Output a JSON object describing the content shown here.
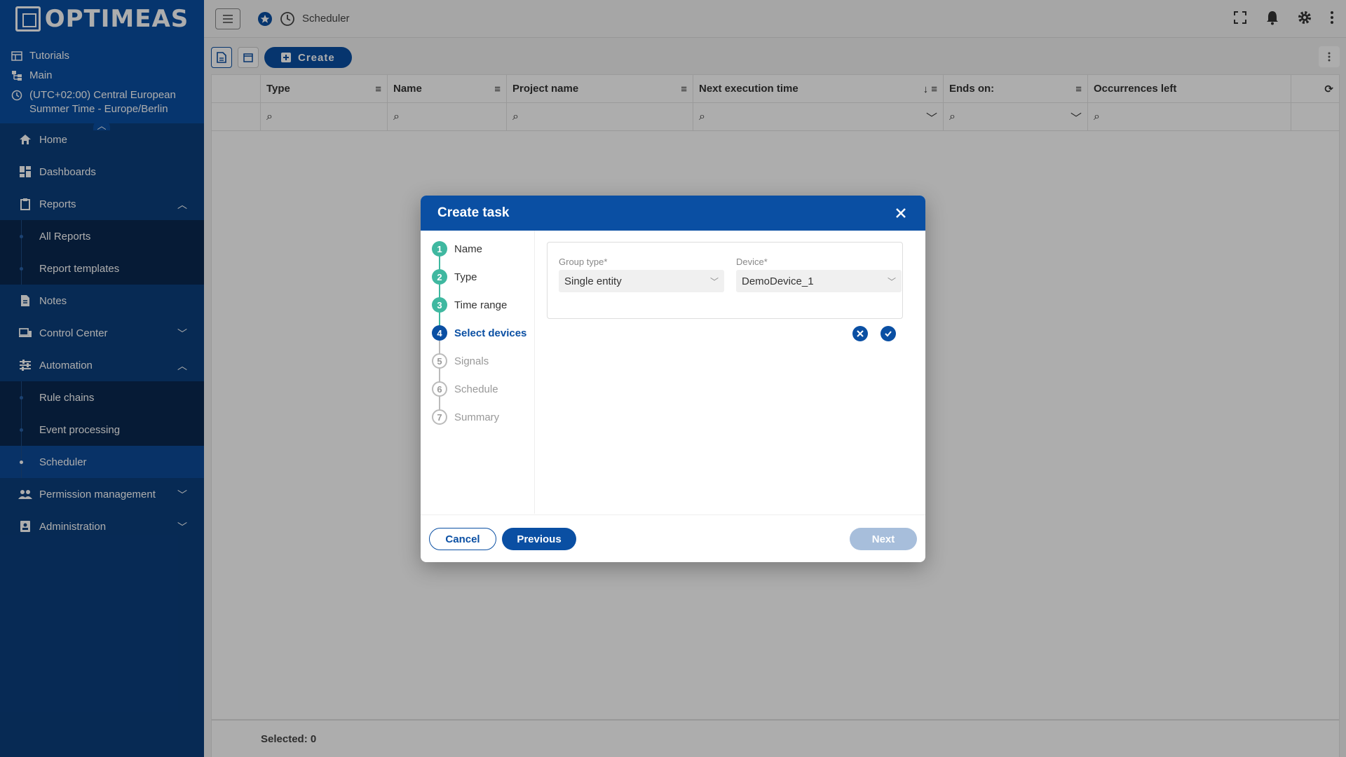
{
  "brand": {
    "name": "OPTIMEAS"
  },
  "meta": {
    "tutorials": "Tutorials",
    "main": "Main",
    "timezone_line1": "(UTC+02:00) Central European",
    "timezone_line2": "Summer Time - Europe/Berlin"
  },
  "nav": {
    "home": "Home",
    "dashboards": "Dashboards",
    "reports": "Reports",
    "all_reports": "All Reports",
    "report_templates": "Report templates",
    "notes": "Notes",
    "control_center": "Control Center",
    "automation": "Automation",
    "rule_chains": "Rule chains",
    "event_processing": "Event processing",
    "scheduler": "Scheduler",
    "permission_management": "Permission management",
    "administration": "Administration"
  },
  "topbar": {
    "page_title": "Scheduler"
  },
  "toolbar": {
    "create_label": "Create"
  },
  "table": {
    "columns": [
      "Type",
      "Name",
      "Project name",
      "Next execution time",
      "Ends on:",
      "Occurrences left"
    ],
    "selected_label": "Selected: 0"
  },
  "dialog": {
    "title": "Create task",
    "steps": [
      {
        "num": "1",
        "label": "Name",
        "state": "done"
      },
      {
        "num": "2",
        "label": "Type",
        "state": "done"
      },
      {
        "num": "3",
        "label": "Time range",
        "state": "done"
      },
      {
        "num": "4",
        "label": "Select devices",
        "state": "current"
      },
      {
        "num": "5",
        "label": "Signals",
        "state": "todo"
      },
      {
        "num": "6",
        "label": "Schedule",
        "state": "todo"
      },
      {
        "num": "7",
        "label": "Summary",
        "state": "todo"
      }
    ],
    "group_type_label": "Group type*",
    "group_type_value": "Single entity",
    "device_label": "Device*",
    "device_value": "DemoDevice_1",
    "cancel_label": "Cancel",
    "previous_label": "Previous",
    "next_label": "Next"
  },
  "colors": {
    "primary": "#0a4fa3",
    "step_done": "#3fb8a0",
    "next_disabled": "#a7bedb"
  }
}
